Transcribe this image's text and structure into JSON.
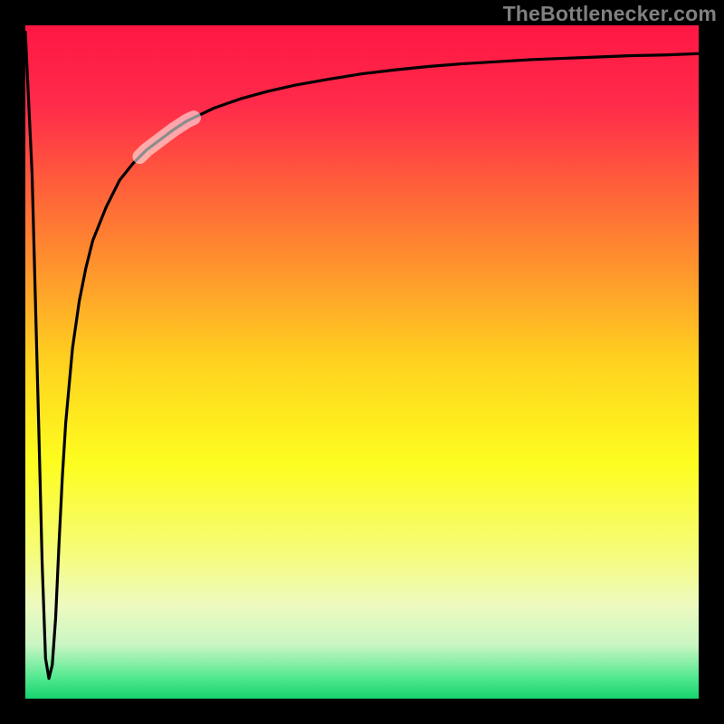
{
  "watermark": "TheBottlenecker.com",
  "chart_data": {
    "type": "line",
    "title": "",
    "xlabel": "",
    "ylabel": "",
    "xlim": [
      0,
      100
    ],
    "ylim": [
      0,
      100
    ],
    "series": [
      {
        "name": "curve",
        "x": [
          0,
          1,
          2,
          2.5,
          3,
          3.5,
          4,
          4.5,
          5,
          5.5,
          6,
          7,
          8,
          9,
          10,
          12,
          14,
          16,
          18,
          20,
          22,
          24,
          28,
          32,
          36,
          40,
          45,
          50,
          55,
          60,
          65,
          70,
          75,
          80,
          85,
          90,
          95,
          100
        ],
        "y": [
          99,
          78,
          40,
          20,
          6,
          3,
          5,
          12,
          23,
          33,
          41,
          52,
          59,
          64,
          68,
          73,
          77,
          79.5,
          81.5,
          83,
          84.5,
          85.8,
          87.7,
          89.1,
          90.2,
          91.1,
          92.0,
          92.8,
          93.4,
          93.9,
          94.3,
          94.6,
          94.9,
          95.1,
          95.3,
          95.5,
          95.6,
          95.8
        ]
      }
    ],
    "highlight_segment": {
      "x_start": 17,
      "x_end": 25
    },
    "gradient_stops": [
      {
        "offset": 0.0,
        "color": "#ff1744"
      },
      {
        "offset": 0.12,
        "color": "#ff2b4a"
      },
      {
        "offset": 0.3,
        "color": "#ff7a33"
      },
      {
        "offset": 0.5,
        "color": "#ffd21f"
      },
      {
        "offset": 0.65,
        "color": "#fdfd1f"
      },
      {
        "offset": 0.78,
        "color": "#f6fc77"
      },
      {
        "offset": 0.86,
        "color": "#eefabf"
      },
      {
        "offset": 0.92,
        "color": "#caf6c3"
      },
      {
        "offset": 0.97,
        "color": "#4fe88e"
      },
      {
        "offset": 1.0,
        "color": "#17d26e"
      }
    ],
    "frame": {
      "color": "#000000",
      "thickness_px": 28
    }
  }
}
